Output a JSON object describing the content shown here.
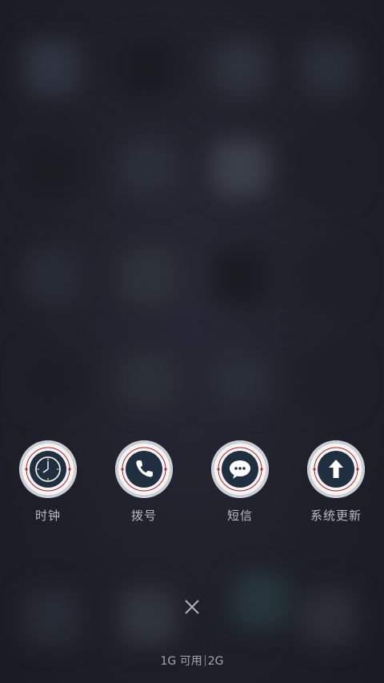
{
  "dock": {
    "items": [
      {
        "label": "时钟",
        "icon": "clock-icon"
      },
      {
        "label": "拨号",
        "icon": "phone-icon"
      },
      {
        "label": "短信",
        "icon": "chat-bubble-icon"
      },
      {
        "label": "系统更新",
        "icon": "arrow-up-icon"
      }
    ]
  },
  "close": {
    "icon": "close-icon"
  },
  "memory": {
    "used": "1G 可用",
    "total": "2G"
  },
  "colors": {
    "background": "#20222c",
    "badge_face": "#f4f4f2",
    "badge_center": "#1f2f40",
    "badge_accent": "#b22233",
    "label_text": "#b8bcc6"
  }
}
